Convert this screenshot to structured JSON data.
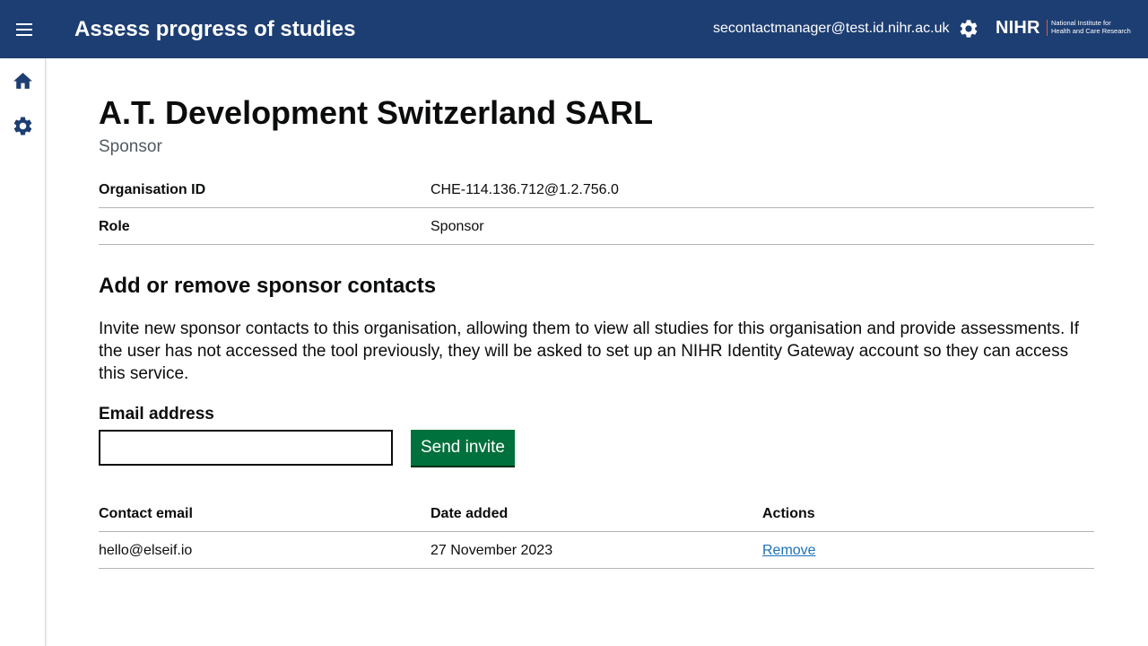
{
  "header": {
    "app_title": "Assess progress of studies",
    "user_email": "secontactmanager@test.id.nihr.ac.uk",
    "logo_main": "NIHR",
    "logo_sub_line1": "National Institute for",
    "logo_sub_line2": "Health and Care Research",
    "background_color": "#1d3e72"
  },
  "sidenav": {
    "items": [
      {
        "icon": "home-icon"
      },
      {
        "icon": "gear-icon"
      }
    ]
  },
  "organisation": {
    "name": "A.T. Development Switzerland SARL",
    "caption": "Sponsor",
    "summary": [
      {
        "key": "Organisation ID",
        "value": "CHE-114.136.712@1.2.756.0"
      },
      {
        "key": "Role",
        "value": "Sponsor"
      }
    ]
  },
  "contacts_section": {
    "heading": "Add or remove sponsor contacts",
    "description": "Invite new sponsor contacts to this organisation, allowing them to view all studies for this organisation and provide assessments. If the user has not accessed the tool previously, they will be asked to set up an NIHR Identity Gateway account so they can access this service.",
    "email_label": "Email address",
    "email_value": "",
    "send_button": "Send invite",
    "button_color": "#00703c",
    "table": {
      "headers": [
        "Contact email",
        "Date added",
        "Actions"
      ],
      "rows": [
        {
          "email": "hello@elseif.io",
          "date_added": "27 November 2023",
          "action": "Remove"
        }
      ]
    }
  }
}
